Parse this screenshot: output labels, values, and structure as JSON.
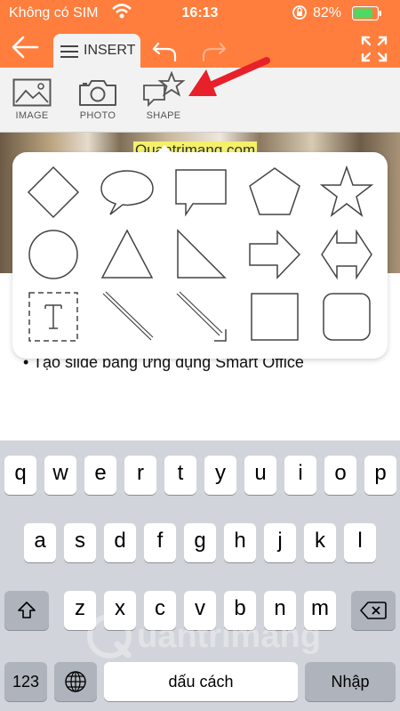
{
  "status": {
    "carrier": "Không có SIM",
    "time": "16:13",
    "battery": "82%",
    "battery_level": 0.82
  },
  "toolbar": {
    "tab_label": "INSERT",
    "icons": [
      "back-arrow-icon",
      "menu-icon",
      "undo-icon",
      "redo-icon",
      "fullscreen-icon"
    ]
  },
  "insert_bar": {
    "items": [
      {
        "label": "IMAGE",
        "icon": "image-icon"
      },
      {
        "label": "PHOTO",
        "icon": "camera-icon"
      },
      {
        "label": "SHAPE",
        "icon": "shape-icon"
      }
    ]
  },
  "document": {
    "image_caption": "Quantrimang.com",
    "bullet_text": "Tạo slide bằng ứng dụng Smart Office"
  },
  "shapes": [
    "diamond",
    "oval-callout",
    "rectangle-callout",
    "pentagon",
    "star",
    "circle",
    "triangle",
    "right-triangle",
    "right-arrow",
    "left-right-arrow",
    "text-box",
    "line",
    "arrow-line",
    "square",
    "rounded-square"
  ],
  "keyboard": {
    "row1": [
      "q",
      "w",
      "e",
      "r",
      "t",
      "y",
      "u",
      "i",
      "o",
      "p"
    ],
    "row2": [
      "a",
      "s",
      "d",
      "f",
      "g",
      "h",
      "j",
      "k",
      "l"
    ],
    "row3": [
      "z",
      "x",
      "c",
      "v",
      "b",
      "n",
      "m"
    ],
    "numbers_label": "123",
    "space_label": "dấu cách",
    "return_label": "Nhập"
  },
  "watermark": "uantrimang",
  "colors": {
    "accent": "#ff7e3d",
    "arrow": "#e8202a"
  }
}
